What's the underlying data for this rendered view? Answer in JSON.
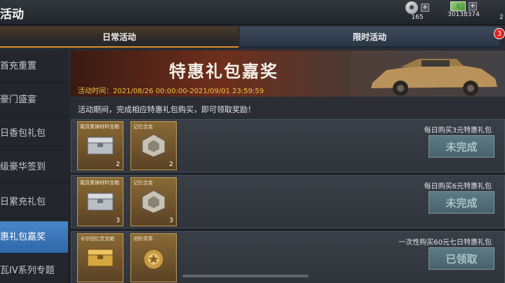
{
  "header": {
    "title": "活动",
    "medal_count": "165",
    "money_count": "30138374",
    "edge_fragment": "2"
  },
  "tabs": [
    {
      "label": "日常活动",
      "active": true
    },
    {
      "label": "限时活动",
      "active": false,
      "badge": "3"
    }
  ],
  "sidebar": {
    "items": [
      {
        "label": "首充重置"
      },
      {
        "label": "豪门盛宴"
      },
      {
        "label": "日香包礼包"
      },
      {
        "label": "级豪华签到"
      },
      {
        "label": "日累充礼包"
      },
      {
        "label": "惠礼包嘉奖",
        "active": true
      },
      {
        "label": "瓦IV系列专题"
      }
    ]
  },
  "banner": {
    "title": "特惠礼包嘉奖",
    "time": "活动时间：2021/08/26 00:00:00-2021/09/01 23:59:59"
  },
  "notice": "活动期间，完成相应特惠礼包购买，即可领取奖励！",
  "rewards": [
    {
      "items": [
        {
          "name": "载具重铸材料宝箱",
          "count": "2",
          "icon": "chest-icon"
        },
        {
          "name": "记忆合金",
          "count": "2",
          "icon": "alloy-icon"
        }
      ],
      "desc": "每日购买3元特惠礼包",
      "status": "未完成"
    },
    {
      "items": [
        {
          "name": "载具重铸材料宝箱",
          "count": "3",
          "icon": "chest-icon"
        },
        {
          "name": "记忆合金",
          "count": "3",
          "icon": "alloy-icon"
        }
      ],
      "desc": "每日购买6元特惠礼包",
      "status": "未完成"
    },
    {
      "items": [
        {
          "name": "卡尔回忆灵宝箱",
          "count": "",
          "icon": "gold-chest-icon"
        },
        {
          "name": "进阶奖章",
          "count": "",
          "icon": "medal-icon"
        }
      ],
      "desc": "一次性购买60元七日特惠礼包",
      "status": "已领取"
    }
  ],
  "colors": {
    "accent_orange": "#e08a2a",
    "sidebar_active": "#2f67a8",
    "time_yellow": "#f0c040",
    "badge_red": "#e02020"
  }
}
